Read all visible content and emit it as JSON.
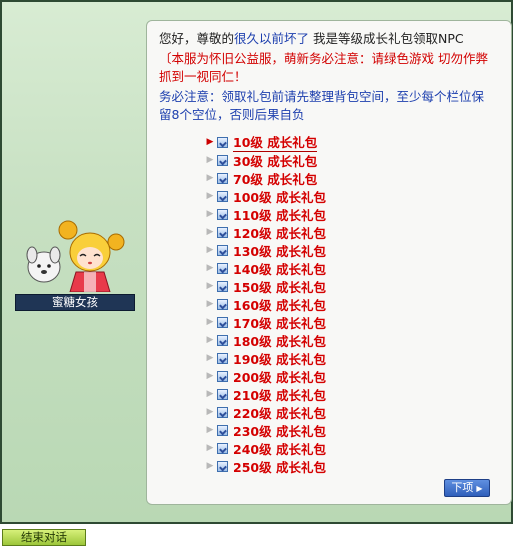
{
  "dialog": {
    "greeting_prefix": "您好，尊敬的",
    "greeting_name": "很久以前坏了",
    "greeting_suffix": " 我是等级成长礼包领取NPC",
    "notice_line1": "〔本服为怀旧公益服，萌新务必注意：请绿色游戏 切勿作弊",
    "notice_line2": "抓到一视同仁！",
    "warning_line1": " 务必注意：领取礼包前请先整理背包空间，至少每个栏位保",
    "warning_line2": "留8个空位，否则后果自负"
  },
  "menu_items": [
    "10级 成长礼包",
    "30级 成长礼包",
    "70级 成长礼包",
    "100级 成长礼包",
    "110级 成长礼包",
    "120级 成长礼包",
    "130级 成长礼包",
    "140级 成长礼包",
    "150级 成长礼包",
    "160级 成长礼包",
    "170级 成长礼包",
    "180级 成长礼包",
    "190级 成长礼包",
    "200级 成长礼包",
    "210级 成长礼包",
    "220级 成长礼包",
    "230级 成长礼包",
    "240级 成长礼包",
    "250级 成长礼包"
  ],
  "npc": {
    "name": "蜜糖女孩",
    "portrait_icon": "npc-girl-with-dog-portrait"
  },
  "buttons": {
    "next_label": "下项",
    "next_icon": "caret-right-icon",
    "end_chat_label": "结束对话"
  },
  "colors": {
    "accent_red": "#d20000",
    "name_blue": "#1d3fae",
    "dialog_bg": "#c7e0c2"
  }
}
